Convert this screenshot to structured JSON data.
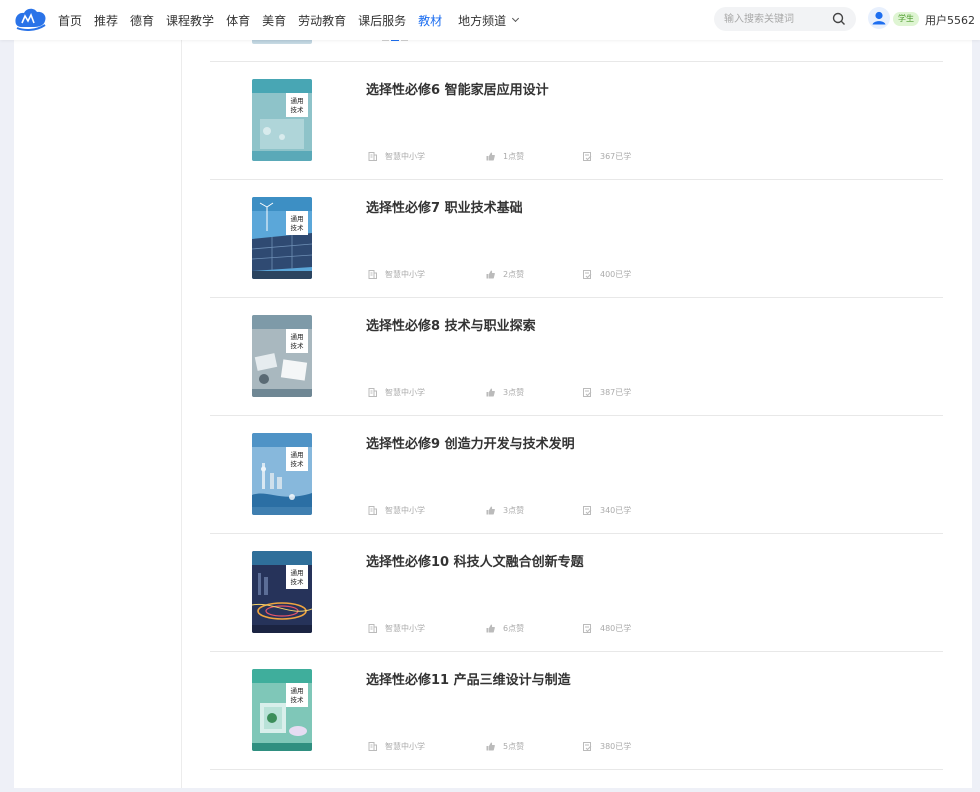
{
  "nav": {
    "items": [
      "首页",
      "推荐",
      "德育",
      "课程教学",
      "体育",
      "美育",
      "劳动教育",
      "课后服务",
      "教材"
    ],
    "active": "教材",
    "region": "地方频道"
  },
  "search": {
    "placeholder": "输入搜索关键词"
  },
  "user": {
    "role": "学生",
    "name": "用户5562"
  },
  "colors": {
    "accent": "#1d6ef0",
    "badge_bg": "#dff5d3",
    "badge_text": "#4a9a2a"
  },
  "icons": [
    "logo-icon",
    "chevron-down-icon",
    "search-icon",
    "user-avatar-icon",
    "publisher-icon",
    "like-icon",
    "learned-icon"
  ],
  "books": [
    {
      "title": "选择性必修6 智能家居应用设计",
      "publisher": "智慧中小学",
      "likes": "1点赞",
      "learned": "367已学",
      "cover_bg": "#5aa9b8"
    },
    {
      "title": "选择性必修7 职业技术基础",
      "publisher": "智慧中小学",
      "likes": "2点赞",
      "learned": "400已学",
      "cover_bg": "#3d8fc4"
    },
    {
      "title": "选择性必修8 技术与职业探索",
      "publisher": "智慧中小学",
      "likes": "3点赞",
      "learned": "387已学",
      "cover_bg": "#7e9aa8"
    },
    {
      "title": "选择性必修9 创造力开发与技术发明",
      "publisher": "智慧中小学",
      "likes": "3点赞",
      "learned": "340已学",
      "cover_bg": "#4f93c6"
    },
    {
      "title": "选择性必修10 科技人文融合创新专题",
      "publisher": "智慧中小学",
      "likes": "6点赞",
      "learned": "480已学",
      "cover_bg": "#2f3f6e"
    },
    {
      "title": "选择性必修11 产品三维设计与制造",
      "publisher": "智慧中小学",
      "likes": "5点赞",
      "learned": "380已学",
      "cover_bg": "#3fae9c"
    }
  ],
  "cover_text": "通用技术"
}
